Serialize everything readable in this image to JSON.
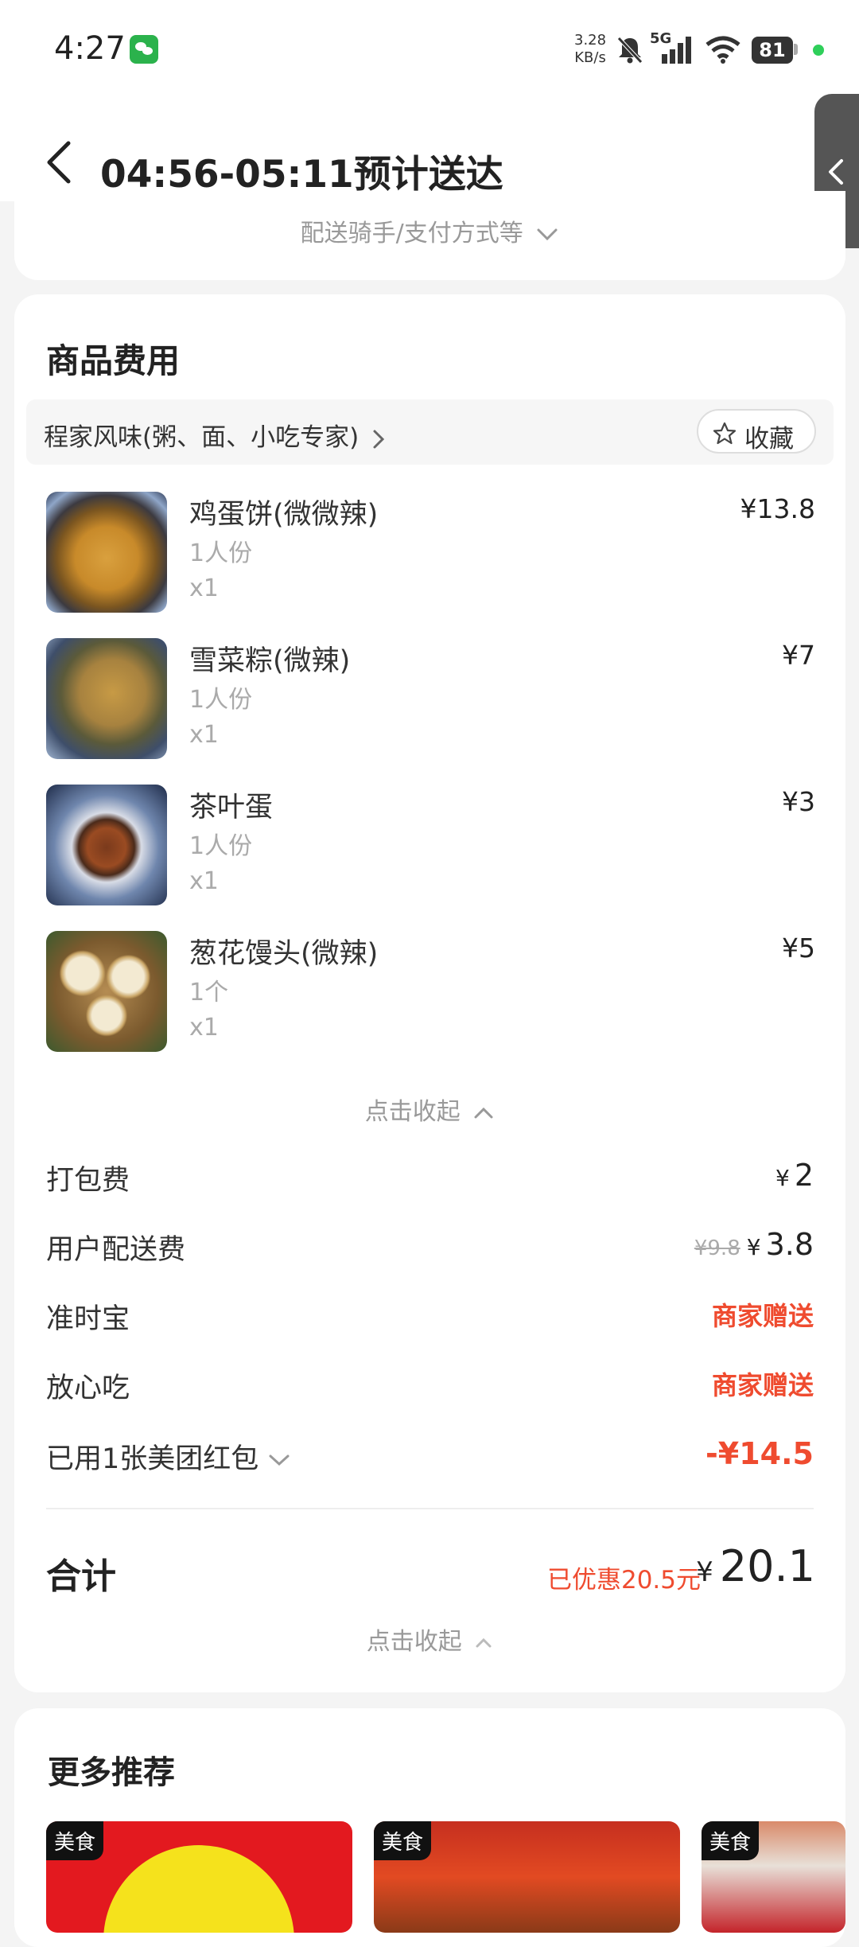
{
  "status_bar": {
    "time": "4:27",
    "net_speed_value": "3.28",
    "net_speed_unit": "KB/s",
    "network": "5G",
    "battery": "81"
  },
  "header": {
    "title": "04:56-05:11预计送达"
  },
  "delivery": {
    "details_link": "配送骑手/支付方式等"
  },
  "fees_section": {
    "title": "商品费用",
    "shop_name": "程家风味(粥、面、小吃专家)",
    "favorite_label": "收藏",
    "items": [
      {
        "name": "鸡蛋饼(微微辣)",
        "spec": "1人份",
        "qty": "x1",
        "price": "¥13.8"
      },
      {
        "name": "雪菜粽(微辣)",
        "spec": "1人份",
        "qty": "x1",
        "price": "¥7"
      },
      {
        "name": "茶叶蛋",
        "spec": "1人份",
        "qty": "x1",
        "price": "¥3"
      },
      {
        "name": "葱花馒头(微辣)",
        "spec": "1个",
        "qty": "x1",
        "price": "¥5"
      }
    ],
    "collapse_items_label": "点击收起",
    "packing_fee": {
      "label": "打包费",
      "currency": "¥",
      "value": "2"
    },
    "delivery_fee": {
      "label": "用户配送费",
      "original": "¥9.8",
      "currency": "¥",
      "value": "3.8"
    },
    "on_time": {
      "label": "准时宝",
      "value": "商家赠送"
    },
    "worry_free": {
      "label": "放心吃",
      "value": "商家赠送"
    },
    "red_packet": {
      "label": "已用1张美团红包",
      "value": "-¥14.5"
    },
    "total": {
      "label": "合计",
      "saved": "已优惠20.5元",
      "currency": "¥",
      "value": "20.1"
    },
    "collapse_fees_label": "点击收起"
  },
  "recommendations": {
    "title": "更多推荐",
    "cards": [
      {
        "tag": "美食"
      },
      {
        "tag": "美食"
      },
      {
        "tag": "美食"
      }
    ]
  },
  "colors": {
    "accent_red": "#ef4b2f",
    "background": "#f4f4f4",
    "card": "#ffffff"
  },
  "icons": [
    "wechat-icon",
    "mute-icon",
    "signal-icon",
    "wifi-icon",
    "back-arrow-icon",
    "chevron-left-icon",
    "chevron-down-icon",
    "chevron-right-icon",
    "star-icon",
    "chevron-up-icon"
  ]
}
